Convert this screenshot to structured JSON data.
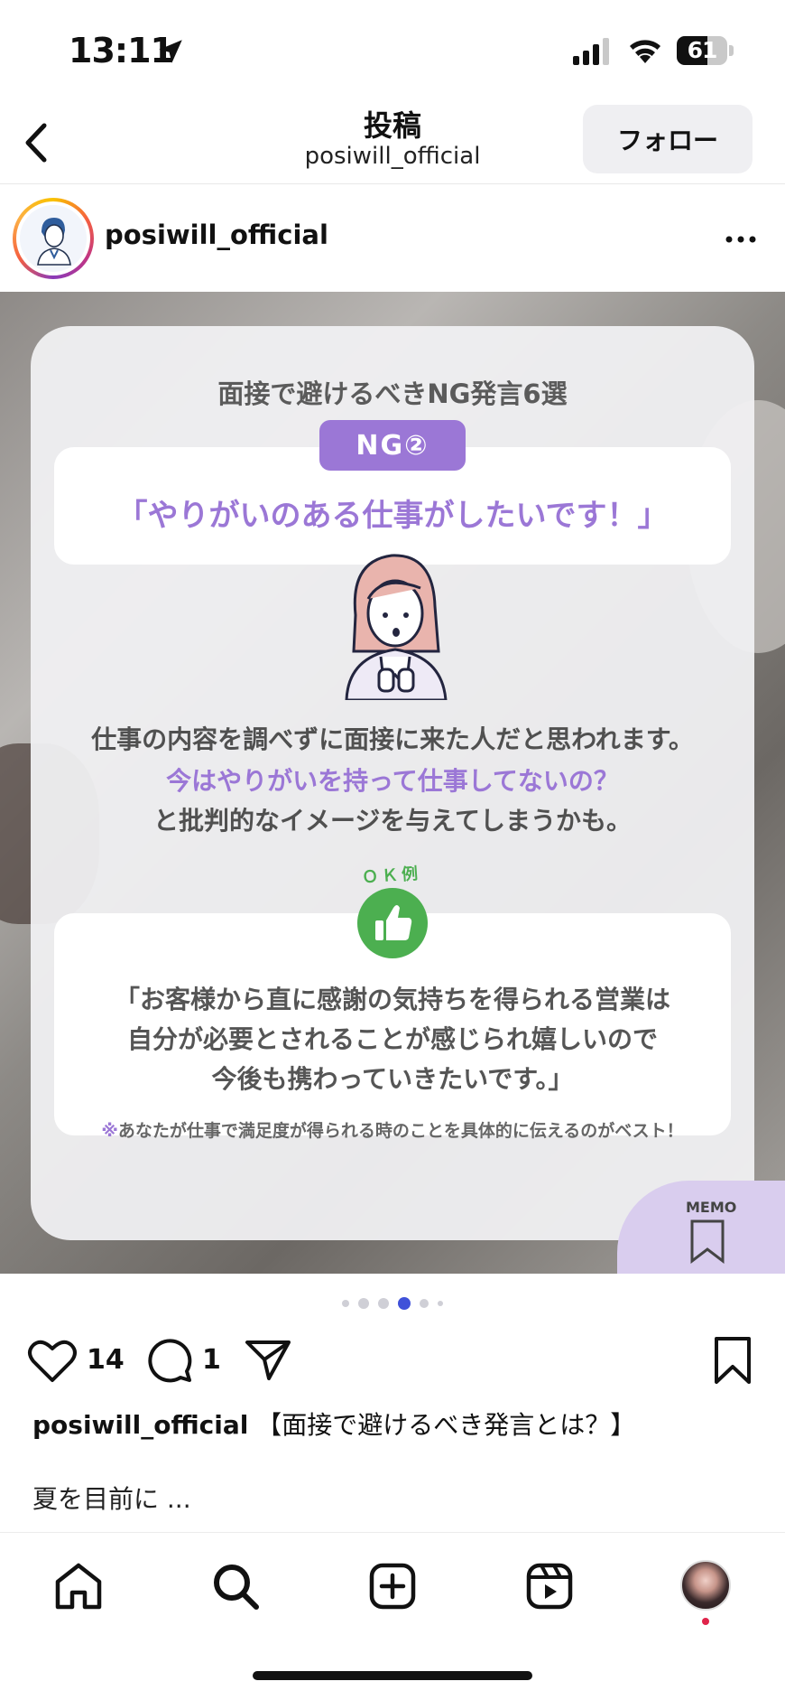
{
  "status_bar": {
    "time": "13:11",
    "battery": "61",
    "battery_level": 0.61
  },
  "header": {
    "title": "投稿",
    "subtitle": "posiwill_official",
    "follow_label": "フォロー"
  },
  "post": {
    "username": "posiwill_official",
    "card": {
      "title": "面接で避けるべきNG発言6選",
      "ng_badge": "NG②",
      "ng_quote": "「やりがいのある仕事がしたいです！」",
      "explanation_1": "仕事の内容を調べずに面接に来た人だと思われます。",
      "explanation_2": "今はやりがいを持って仕事してないの？",
      "explanation_3": "と批判的なイメージを与えてしまうかも。",
      "ok_label": "ＯＫ例",
      "ok_line_1": "「お客様から直に感謝の気持ちを得られる営業は",
      "ok_line_2": "自分が必要とされることが感じられ嬉しいので",
      "ok_line_3": "今後も携わっていきたいです。」",
      "note_mark": "※",
      "note_text": "あなたが仕事で満足度が得られる時のことを具体的に伝えるのがベスト！",
      "memo_label": "MEMO"
    },
    "carousel": {
      "total": 6,
      "active_index": 3
    },
    "likes": "14",
    "comments": "1",
    "caption_user": "posiwill_official",
    "caption_text": "【面接で避けるべき発言とは？】",
    "caption_more": "夏を目前に ..."
  },
  "colors": {
    "accent_purple": "#9b77d6",
    "ok_green": "#4caf50",
    "dot_active": "#3f51d9"
  },
  "icons": [
    "location-arrow-icon",
    "signal-icon",
    "wifi-icon",
    "back-chevron-icon",
    "more-icon",
    "heart-icon",
    "comment-icon",
    "share-icon",
    "bookmark-icon",
    "home-icon",
    "search-icon",
    "create-icon",
    "reels-icon"
  ]
}
